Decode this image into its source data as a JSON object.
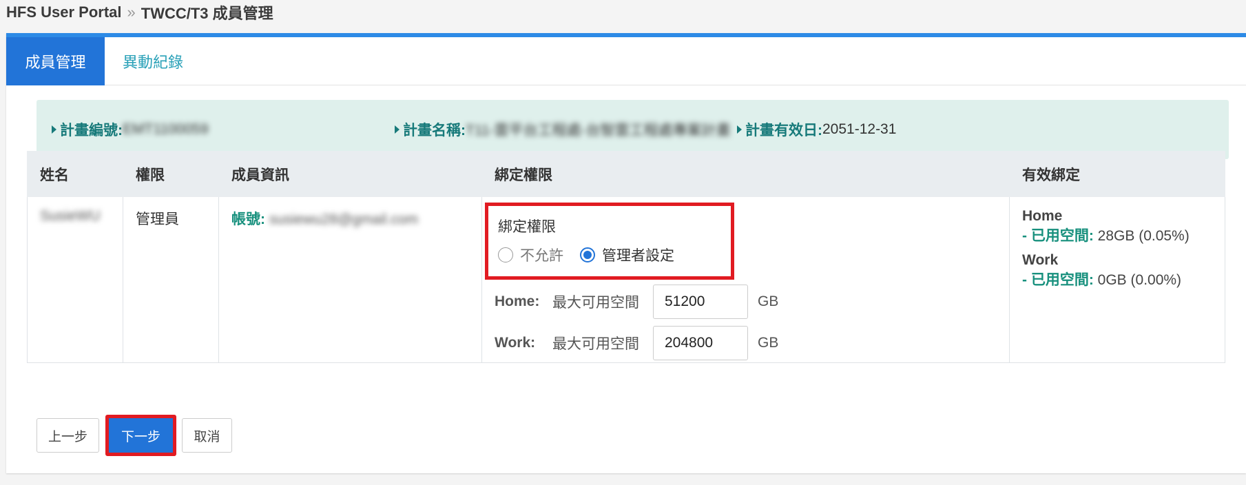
{
  "breadcrumb": {
    "root": "HFS User Portal",
    "separator": "»",
    "current": "TWCC/T3 成員管理"
  },
  "tabs": [
    {
      "label": "成員管理",
      "active": true
    },
    {
      "label": "異動紀錄",
      "active": false
    }
  ],
  "plan": {
    "id_label": "計畫編號:",
    "id_value": "EMT1100059",
    "name_label": "計畫名稱:",
    "name_value": "T11-雲平台工程處-台智雲工程處專案計畫",
    "expiry_label": "計畫有效日:",
    "expiry_value": "2051-12-31"
  },
  "table": {
    "headers": [
      "姓名",
      "權限",
      "成員資訊",
      "綁定權限",
      "有效綁定"
    ],
    "row": {
      "name": "SusieWU",
      "role": "管理員",
      "account_label": "帳號:",
      "account_value": "susiewu28@gmail.com",
      "binding": {
        "title": "綁定權限",
        "options": [
          {
            "label": "不允許",
            "checked": false
          },
          {
            "label": "管理者設定",
            "checked": true
          }
        ],
        "quotas": [
          {
            "name": "Home:",
            "desc": "最大可用空間",
            "value": "51200",
            "unit": "GB"
          },
          {
            "name": "Work:",
            "desc": "最大可用空間",
            "value": "204800",
            "unit": "GB"
          }
        ]
      },
      "effective": [
        {
          "title": "Home",
          "prefix": "- ",
          "label": "已用空間:",
          "value": " 28GB (0.05%)"
        },
        {
          "title": "Work",
          "prefix": "- ",
          "label": "已用空間:",
          "value": " 0GB (0.00%)"
        }
      ]
    }
  },
  "buttons": {
    "prev": "上一步",
    "next": "下一步",
    "cancel": "取消"
  },
  "colors": {
    "accent": "#2274d8",
    "highlight": "#e11b22",
    "teal": "#17907d"
  }
}
